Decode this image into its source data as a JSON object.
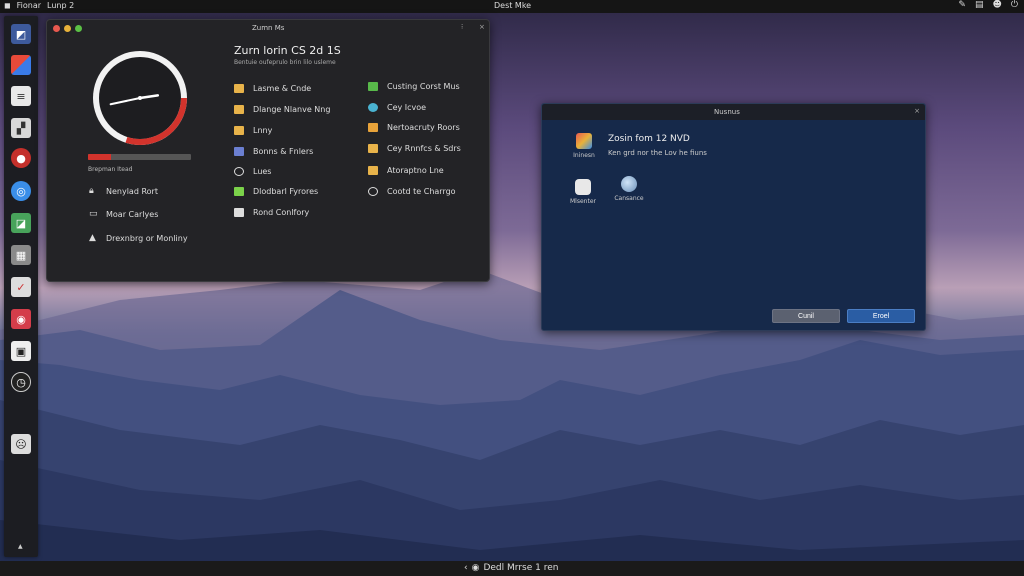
{
  "topbar": {
    "left_items": [
      "Fionar",
      "Lunp 2"
    ],
    "center_title": "Dest Mke",
    "right_icons": [
      "pen-icon",
      "doc-icon",
      "person-icon",
      "power-icon"
    ]
  },
  "dock": {
    "icons": [
      "files-icon",
      "photos-icon",
      "notes-icon",
      "editor-icon",
      "record-icon",
      "browser-icon",
      "maps-icon",
      "archive-icon",
      "brush-icon",
      "camera-icon",
      "terminal-icon",
      "clock-icon",
      "face-icon"
    ]
  },
  "bottombar": {
    "text": "Dedl Mrrse 1 ren"
  },
  "window1": {
    "title": "Zumn Ms",
    "heading": "Zurn lorin CS 2d 1S",
    "subheading": "Bentuie oufeprulo brin lilo usleme",
    "clock": {
      "hour": 2,
      "minute": 43,
      "progress_fraction": 0.6
    },
    "progress": {
      "fraction": 0.22,
      "label": "Brepman Itead"
    },
    "left_list": [
      {
        "icon": "lock-icon",
        "label": "Nenylad Rort"
      },
      {
        "icon": "laptop-icon",
        "label": "Moar Carlyes"
      },
      {
        "icon": "user-icon",
        "label": "Drexnbrg or Monliny"
      }
    ],
    "menu_col1": [
      {
        "icon": "folder-icon",
        "label": "Lasme & Cnde",
        "color": "#e8b34a"
      },
      {
        "icon": "folder-icon",
        "label": "Dlange Nlanve Nng",
        "color": "#e8b34a"
      },
      {
        "icon": "folder-icon",
        "label": "Lnny",
        "color": "#e8b34a"
      },
      {
        "icon": "calendar-icon",
        "label": "Bonns & Fnlers",
        "color": "#6b7fd1"
      },
      {
        "icon": "circle-icon",
        "label": "Lues",
        "color": "#dddddd"
      },
      {
        "icon": "trash-icon",
        "label": "Dlodbarl Fyrores",
        "color": "#7bd24a"
      },
      {
        "icon": "drive-icon",
        "label": "Rond Conlfory",
        "color": "#dddddd"
      }
    ],
    "menu_col2": [
      {
        "icon": "chart-icon",
        "label": "Custing Corst Mus",
        "color": "#58b94a"
      },
      {
        "icon": "globe-icon",
        "label": "Cey Icvoe",
        "color": "#4ab3d1"
      },
      {
        "icon": "bag-icon",
        "label": "Nertoacruty Roors",
        "color": "#e8a33a"
      },
      {
        "icon": "folder-icon",
        "label": "Cey Rnnfcs & Sdrs",
        "color": "#e8b34a"
      },
      {
        "icon": "folder-icon",
        "label": "Atoraptno Lne",
        "color": "#e8b34a"
      },
      {
        "icon": "chrome-icon",
        "label": "Cootd te Charrgo",
        "color": "#dddddd"
      }
    ]
  },
  "window2": {
    "title": "Nusnus",
    "heading": "Zosin fom 12 NVD",
    "subheading": "Ken grd nor the Lov he fiuns",
    "app_icon_label": "Ininesn",
    "icons": [
      {
        "icon": "monitor-icon",
        "label": "Mlsenter"
      },
      {
        "icon": "globe-icon",
        "label": "Cansance"
      }
    ],
    "buttons": {
      "cancel": "Cunil",
      "ok": "Eroel"
    }
  }
}
